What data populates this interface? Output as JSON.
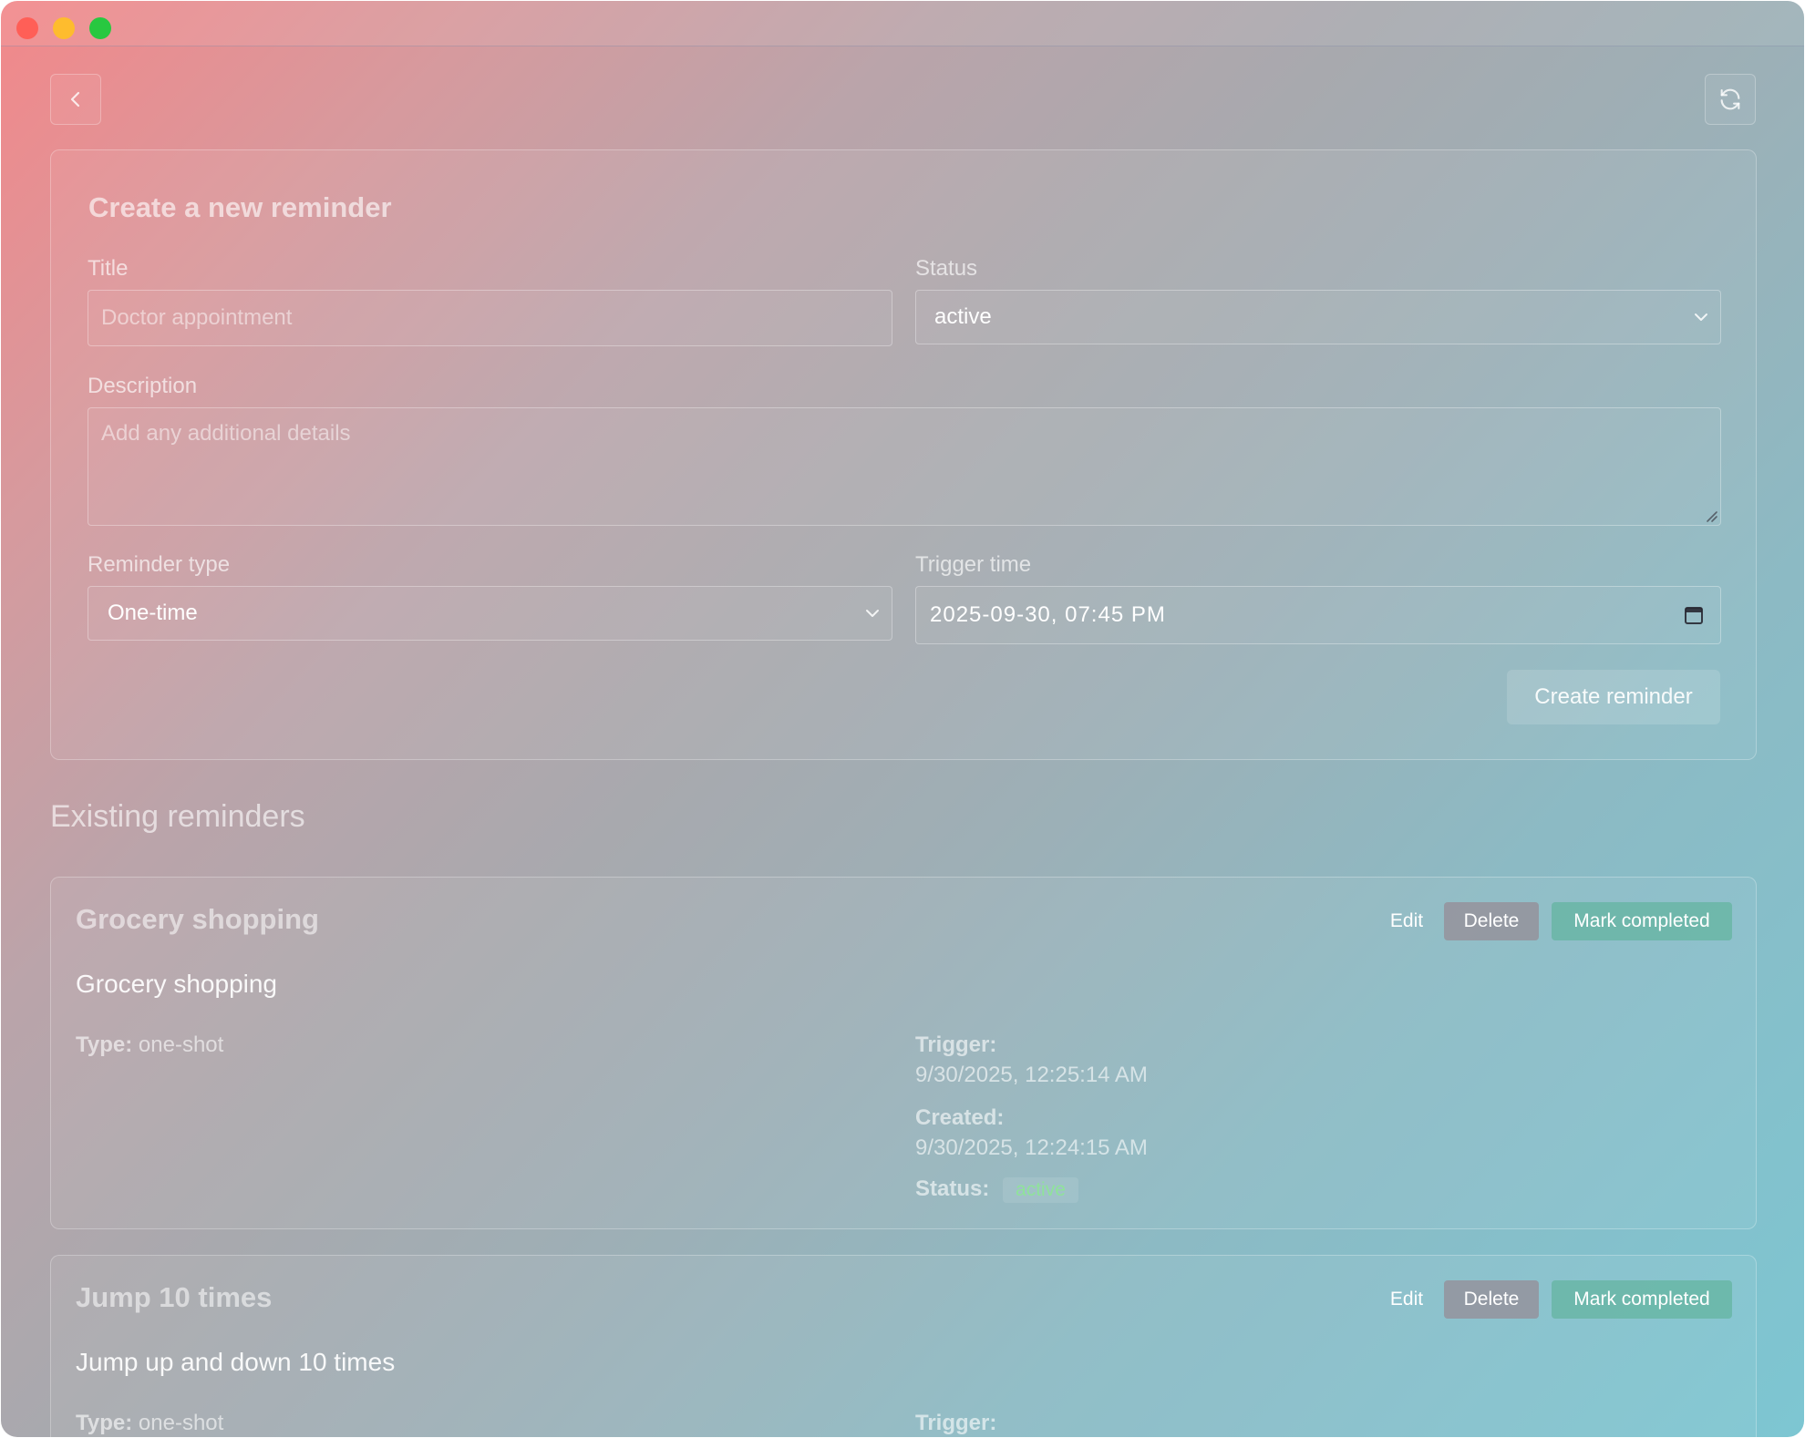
{
  "form": {
    "heading": "Create a new reminder",
    "title_label": "Title",
    "title_placeholder": "Doctor appointment",
    "status_label": "Status",
    "status_value": "active",
    "description_label": "Description",
    "description_placeholder": "Add any additional details",
    "type_label": "Reminder type",
    "type_value": "One-time",
    "trigger_label": "Trigger time",
    "trigger_value": "2025-09-30, 07:45 PM",
    "submit_label": "Create reminder"
  },
  "existing": {
    "heading": "Existing reminders",
    "labels": {
      "type": "Type:",
      "trigger": "Trigger:",
      "created": "Created:",
      "status": "Status:"
    },
    "actions": {
      "edit": "Edit",
      "delete": "Delete",
      "complete": "Mark completed"
    },
    "items": [
      {
        "title": "Grocery shopping",
        "description": "Grocery shopping",
        "type": "one-shot",
        "trigger": "9/30/2025, 12:25:14 AM",
        "created": "9/30/2025, 12:24:15 AM",
        "status": "active"
      },
      {
        "title": "Jump 10 times",
        "description": "Jump up and down 10 times",
        "type": "one-shot"
      }
    ]
  },
  "icons": {
    "back": "chevron-left-icon",
    "refresh": "refresh-icon",
    "calendar": "calendar-icon",
    "dropdown": "chevron-down-icon"
  },
  "colors": {
    "status_active": "#8fe39a",
    "complete_button": "#64b4a0",
    "delete_button": "#968c96"
  }
}
